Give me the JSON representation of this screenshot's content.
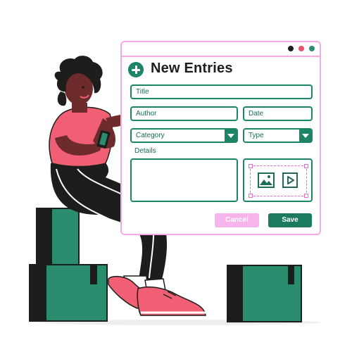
{
  "form": {
    "title": "New Entries",
    "fields": {
      "title": "Title",
      "author": "Author",
      "date": "Date",
      "category": "Category",
      "type": "Type",
      "details": "Details"
    },
    "buttons": {
      "cancel": "Cancel",
      "save": "Save"
    }
  },
  "icons": [
    "plus-circle-icon",
    "image-icon",
    "video-play-icon",
    "dropdown-caret-icon"
  ],
  "colors": {
    "accent_green": "#1c8565",
    "border_pink": "#f5a9e6",
    "cancel_pink": "#f7b3ec",
    "shirt_coral": "#f05f73",
    "box_teal": "#2a8c6f"
  }
}
